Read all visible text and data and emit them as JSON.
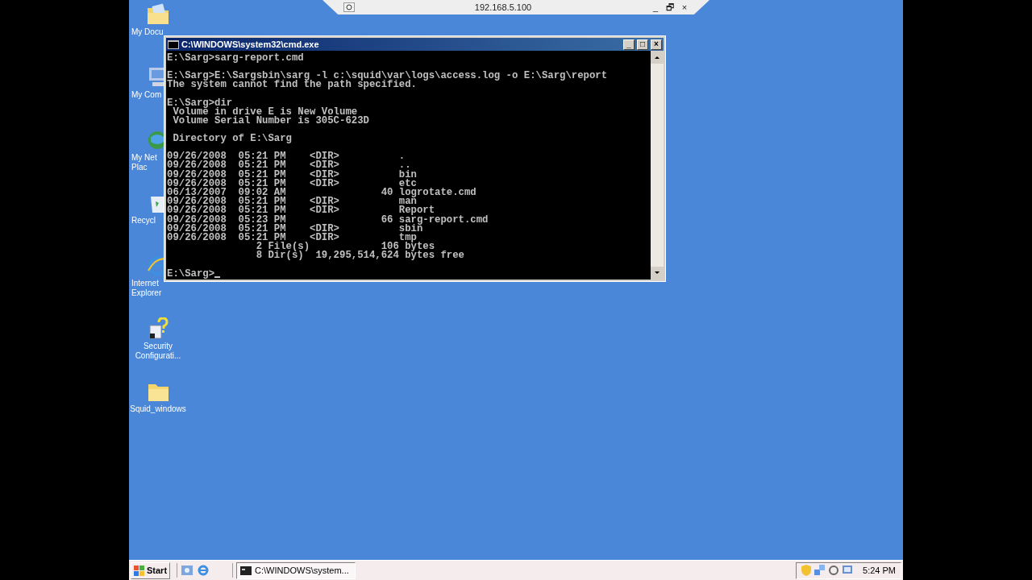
{
  "remote_bar": {
    "host": "192.168.5.100",
    "buttons": [
      "_",
      "🗗",
      "×"
    ]
  },
  "desktop_icons": [
    {
      "kind": "documents",
      "label": "My Docu"
    },
    {
      "kind": "computer",
      "label": "My Com"
    },
    {
      "kind": "network",
      "label": "My Net\nPlac"
    },
    {
      "kind": "recycle",
      "label": "Recycl"
    },
    {
      "kind": "ie",
      "label": "Internet\nExplorer"
    },
    {
      "kind": "security",
      "label": "Security\nConfigurati..."
    },
    {
      "kind": "folder",
      "label": "Squid_windows"
    }
  ],
  "console_window": {
    "title": "C:\\WINDOWS\\system32\\cmd.exe",
    "buttons": [
      "_",
      "□",
      "×"
    ],
    "blocks": [
      [
        "E:\\Sarg>sarg-report.cmd"
      ],
      [
        "E:\\Sarg>E:\\Sargsbin\\sarg -l c:\\squid\\var\\logs\\access.log -o E:\\Sarg\\report",
        "The system cannot find the path specified."
      ],
      [
        "E:\\Sarg>dir",
        " Volume in drive E is New Volume",
        " Volume Serial Number is 305C-623D"
      ],
      [
        " Directory of E:\\Sarg"
      ],
      [
        "09/26/2008  05:21 PM    <DIR>          .",
        "09/26/2008  05:21 PM    <DIR>          ..",
        "09/26/2008  05:21 PM    <DIR>          bin",
        "09/26/2008  05:21 PM    <DIR>          etc",
        "06/13/2007  09:02 AM                40 logrotate.cmd",
        "09/26/2008  05:21 PM    <DIR>          man",
        "09/26/2008  05:21 PM    <DIR>          Report",
        "09/26/2008  05:23 PM                66 sarg-report.cmd",
        "09/26/2008  05:21 PM    <DIR>          sbin",
        "09/26/2008  05:21 PM    <DIR>          tmp",
        "               2 File(s)            106 bytes",
        "               8 Dir(s)  19,295,514,624 bytes free"
      ],
      [
        "E:\\Sarg>"
      ]
    ],
    "cursor": true
  },
  "taskbar": {
    "start": "Start",
    "tasks": [
      {
        "label": "C:\\WINDOWS\\system...",
        "selected": true
      }
    ],
    "clock": "5:24 PM"
  }
}
